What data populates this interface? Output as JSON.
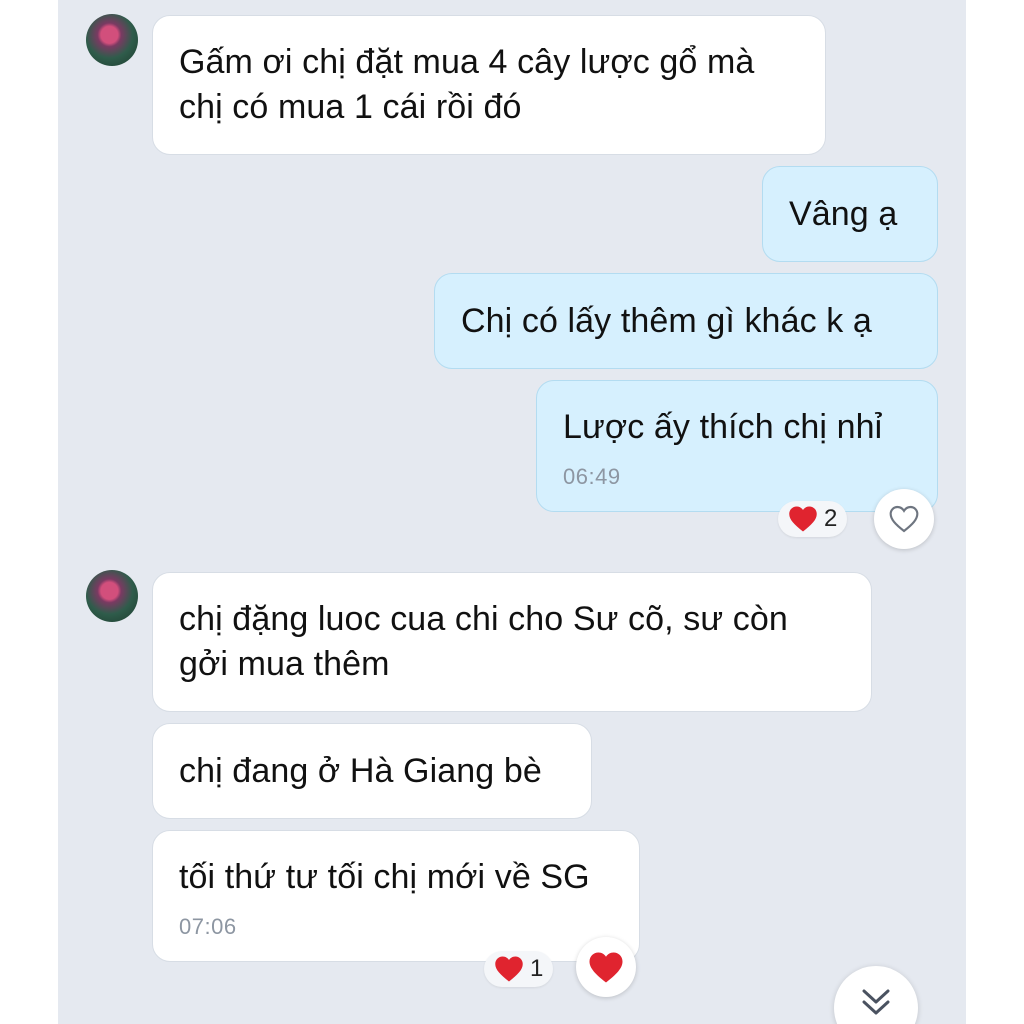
{
  "messages": [
    {
      "direction": "in",
      "text": "Gấm ơi chị đặt mua 4 cây lược gổ mà\nchị có mua 1 cái rồi đó"
    },
    {
      "direction": "out",
      "text": "Vâng ạ"
    },
    {
      "direction": "out",
      "text": "Chị có lấy thêm gì khác k ạ"
    },
    {
      "direction": "out",
      "text": "Lược ấy thích chị nhỉ",
      "time": "06:49",
      "reaction_count": "2"
    },
    {
      "direction": "in",
      "text": "chị đặng luoc cua chi cho Sư cõ, sư còn\ngởi mua thêm"
    },
    {
      "direction": "in",
      "text": "chị đang ở Hà Giang bè"
    },
    {
      "direction": "in",
      "text": "tối thứ tư tối chị mới về SG",
      "time": "07:06",
      "reaction_count": "1"
    }
  ],
  "colors": {
    "chat_background": "#e5e9f0",
    "incoming_bubble": "#ffffff",
    "outgoing_bubble": "#d6f0fe",
    "heart": "#e0242f"
  },
  "icons": {
    "reaction_heart": "heart-icon",
    "react_button_outline": "heart-outline-icon",
    "react_button_filled": "heart-icon",
    "scroll_down": "double-chevron-down-icon"
  }
}
